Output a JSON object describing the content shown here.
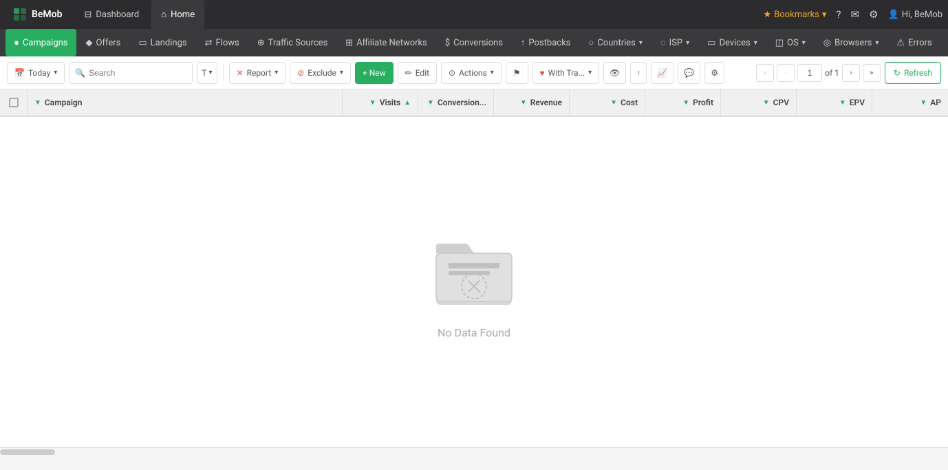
{
  "brand": {
    "name": "BeMob",
    "logo_unicode": "⊞"
  },
  "top_nav": {
    "tabs": [
      {
        "id": "dashboard",
        "label": "Dashboard",
        "icon": "⊟",
        "active": false
      },
      {
        "id": "home",
        "label": "Home",
        "icon": "⌂",
        "active": true
      }
    ],
    "right": {
      "bookmarks_label": "Bookmarks",
      "help_icon": "?",
      "messages_icon": "✉",
      "settings_icon": "⚙",
      "user_label": "Hi, BeMob"
    }
  },
  "second_nav": {
    "items": [
      {
        "id": "campaigns",
        "label": "Campaigns",
        "icon": "●",
        "active": true
      },
      {
        "id": "offers",
        "label": "Offers",
        "icon": "◆",
        "active": false
      },
      {
        "id": "landings",
        "label": "Landings",
        "icon": "▭",
        "active": false
      },
      {
        "id": "flows",
        "label": "Flows",
        "icon": "⇄",
        "active": false
      },
      {
        "id": "traffic-sources",
        "label": "Traffic Sources",
        "icon": "⊕",
        "active": false
      },
      {
        "id": "affiliate-networks",
        "label": "Affiliate Networks",
        "icon": "⊞",
        "active": false
      },
      {
        "id": "conversions",
        "label": "Conversions",
        "icon": "$",
        "active": false
      },
      {
        "id": "postbacks",
        "label": "Postbacks",
        "icon": "↑",
        "active": false
      },
      {
        "id": "countries",
        "label": "Countries",
        "icon": "○",
        "active": false
      },
      {
        "id": "isp",
        "label": "ISP",
        "icon": "◌",
        "active": false
      },
      {
        "id": "devices",
        "label": "Devices",
        "icon": "▭",
        "active": false
      },
      {
        "id": "os",
        "label": "OS",
        "icon": "◫",
        "active": false
      },
      {
        "id": "browsers",
        "label": "Browsers",
        "icon": "◎",
        "active": false
      },
      {
        "id": "errors",
        "label": "Errors",
        "icon": "⚠",
        "active": false
      }
    ]
  },
  "toolbar": {
    "date_btn": "Today",
    "search_placeholder": "Search",
    "search_type": "T",
    "report_btn": "Report",
    "exclude_btn": "Exclude",
    "new_btn": "+ New",
    "edit_btn": "Edit",
    "edit_icon": "✏",
    "actions_btn": "Actions",
    "flag_btn": "",
    "with_tracking_btn": "With Tra...",
    "page_current": "1",
    "page_of": "of 1",
    "refresh_btn": "Refresh"
  },
  "table": {
    "columns": [
      {
        "id": "campaign",
        "label": "Campaign",
        "type": "text",
        "sortable": true,
        "sorted": false
      },
      {
        "id": "visits",
        "label": "Visits",
        "type": "number",
        "sortable": true,
        "sorted": true,
        "sort_dir": "desc"
      },
      {
        "id": "conversions",
        "label": "Conversion...",
        "type": "number",
        "sortable": true,
        "sorted": false
      },
      {
        "id": "revenue",
        "label": "Revenue",
        "type": "number",
        "sortable": true,
        "sorted": false
      },
      {
        "id": "cost",
        "label": "Cost",
        "type": "number",
        "sortable": true,
        "sorted": false
      },
      {
        "id": "profit",
        "label": "Profit",
        "type": "number",
        "sortable": true,
        "sorted": false
      },
      {
        "id": "cpv",
        "label": "CPV",
        "type": "number",
        "sortable": true,
        "sorted": false
      },
      {
        "id": "epv",
        "label": "EPV",
        "type": "number",
        "sortable": true,
        "sorted": false
      },
      {
        "id": "ap",
        "label": "AP",
        "type": "number",
        "sortable": true,
        "sorted": false
      }
    ],
    "rows": [],
    "empty_state": {
      "text": "No Data Found"
    }
  },
  "colors": {
    "accent": "#27ae60",
    "nav_bg": "#2c2c2e",
    "second_nav_bg": "#3a3a3c",
    "empty_icon": "#c8c8c8"
  }
}
